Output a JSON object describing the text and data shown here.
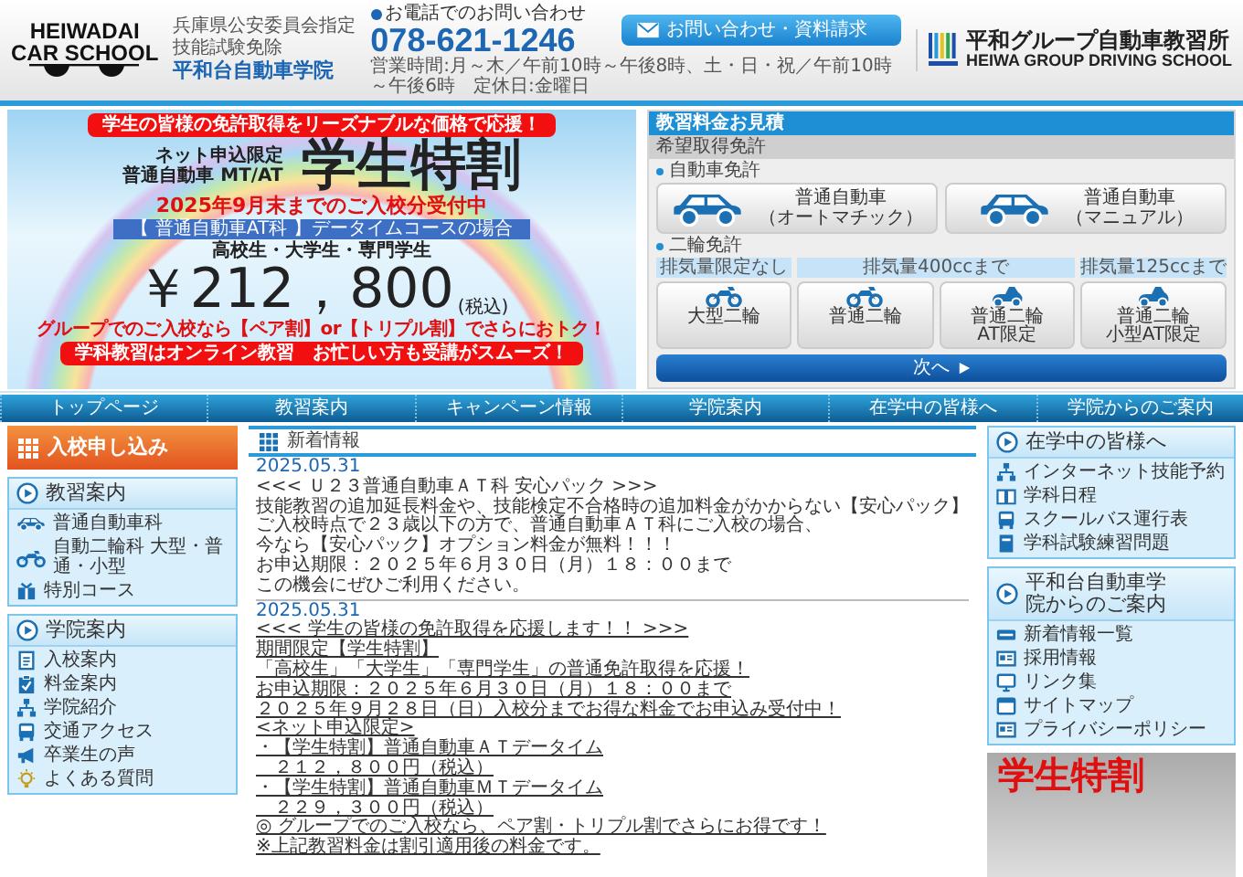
{
  "header": {
    "logo_lines": [
      "HEIWADAI",
      "CAR SCHOOL"
    ],
    "authority": [
      "兵庫県公安委員会指定",
      "技能試験免除"
    ],
    "school_name": "平和台自動車学院",
    "phone_label": "お電話でのお問い合わせ",
    "phone": "078-621-1246",
    "hours": "営業時間:月～木／午前10時～午後8時、土・日・祝／午前10時～午後6時　定休日:金曜日",
    "contact_button": "お問い合わせ・資料請求",
    "group_name": "平和グループ自動車教習所",
    "group_name_en": "HEIWA GROUP DRIVING SCHOOL"
  },
  "banner": {
    "top_ribbon": "学生の皆様の免許取得をリーズナブルな価格で応援！",
    "limited": "ネット申込限定",
    "course": "普通自動車 MT/AT",
    "headline": "学生特割",
    "deadline": "2025年9月末までのご入校分受付中",
    "course_strip": "【 普通自動車AT科 】データイムコースの場合",
    "eligible": "高校生・大学生・専門学生",
    "price": "￥212，800",
    "tax": "(税込)",
    "group_note": "グループでのご入校なら【ペア割】or【トリプル割】でさらにおトク！",
    "bottom_ribbon": "学科教習はオンライン教習　お忙しい方も受講がスムーズ！"
  },
  "estimate": {
    "title": "教習料金お見積",
    "subtitle": "希望取得免許",
    "car_section": "自動車免許",
    "cars": [
      [
        "普通自動車",
        "（オートマチック）"
      ],
      [
        "普通自動車",
        "（マニュアル）"
      ]
    ],
    "moto_section": "二輪免許",
    "moto_groups": [
      {
        "label": "排気量限定なし",
        "items": [
          [
            "大型二輪"
          ]
        ]
      },
      {
        "label": "排気量400ccまで",
        "items": [
          [
            "普通二輪"
          ],
          [
            "普通二輪",
            "AT限定"
          ]
        ]
      },
      {
        "label": "排気量125ccまで",
        "items": [
          [
            "普通二輪",
            "小型AT限定"
          ]
        ]
      }
    ],
    "next_button": "次へ"
  },
  "nav": [
    "トップページ",
    "教習案内",
    "キャンペーン情報",
    "学院案内",
    "在学中の皆様へ",
    "学院からのご案内"
  ],
  "left_sidebar": {
    "apply_button": "入校申し込み",
    "boxes": [
      {
        "title": "教習案内",
        "items": [
          "普通自動車科",
          "自動二輪科 大型・普通・小型",
          "特別コース"
        ]
      },
      {
        "title": "学院案内",
        "items": [
          "入校案内",
          "料金案内",
          "学院紹介",
          "交通アクセス",
          "卒業生の声",
          "よくある質問"
        ]
      }
    ]
  },
  "news": {
    "title": "新着情報",
    "items": [
      {
        "kind": "text",
        "date": "2025.05.31",
        "lines": [
          "<<< Ｕ２３普通自動車ＡＴ科 安心パック >>>",
          "技能教習の追加延長料金や、技能検定不合格時の追加料金がかからない【安心パック】",
          "ご入校時点で２３歳以下の方で、普通自動車ＡＴ科にご入校の場合、",
          "今なら【安心パック】オプション料金が無料！！！",
          "お申込期限：２０２５年６月３０日（月）１８：００まで",
          "この機会にぜひご利用ください。"
        ]
      },
      {
        "kind": "link",
        "date": "2025.05.31",
        "lines": [
          "<<< 学生の皆様の免許取得を応援します！！ >>>",
          "期間限定【学生特割】",
          "「高校生」「大学生」「専門学生」の普通免許取得を応援！",
          "お申込期限：２０２５年６月３０日（月）１８：００まで",
          "２０２５年９月２８日（日）入校分までお得な料金でお申込み受付中！",
          "<ネット申込限定>",
          "・【学生特割】普通自動車ＡＴデータイム",
          "　２１２，８００円（税込）",
          "・【学生特割】普通自動車ＭＴデータイム",
          "　２２９，３００円（税込）",
          "◎ グループでのご入校なら、ペア割・トリプル割でさらにお得です！",
          "※上記教習料金は割引適用後の料金です。"
        ]
      }
    ]
  },
  "right_sidebar": {
    "boxes": [
      {
        "title": "在学中の皆様へ",
        "items": [
          "インターネット技能予約",
          "学科日程",
          "スクールバス運行表",
          "学科試験練習問題"
        ]
      },
      {
        "title": "平和台自動車学院からのご案内",
        "items": [
          "新着情報一覧",
          "採用情報",
          "リンク集",
          "サイトマップ",
          "プライバシーポリシー"
        ]
      }
    ],
    "promo": "学生特割"
  }
}
